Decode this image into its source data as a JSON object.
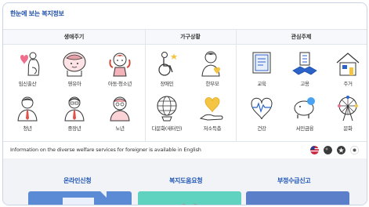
{
  "title": "한눈에 보는 복지정보",
  "headers": {
    "life": "생애주기",
    "household": "가구상황",
    "interest": "관심주제"
  },
  "life": [
    "임신출산",
    "영유아",
    "아동·청소년",
    "청년",
    "중장년",
    "노년"
  ],
  "household": [
    "장애인",
    "한부모",
    "다문화(새터민)",
    "저소득층"
  ],
  "interest": [
    "교육",
    "고용",
    "주거",
    "건강",
    "서민금융",
    "문화"
  ],
  "info": "Information on the diverse welfare services for foreigner is available in English",
  "services": [
    "온라인신청",
    "복지도움요청",
    "부정수급신고"
  ],
  "colors": {
    "accent": "#1f4fa8",
    "service": "#1f55b5",
    "thumb1": "#5b8bd4",
    "thumb2": "#5fd3c0",
    "thumb3": "#5b7fc9"
  }
}
